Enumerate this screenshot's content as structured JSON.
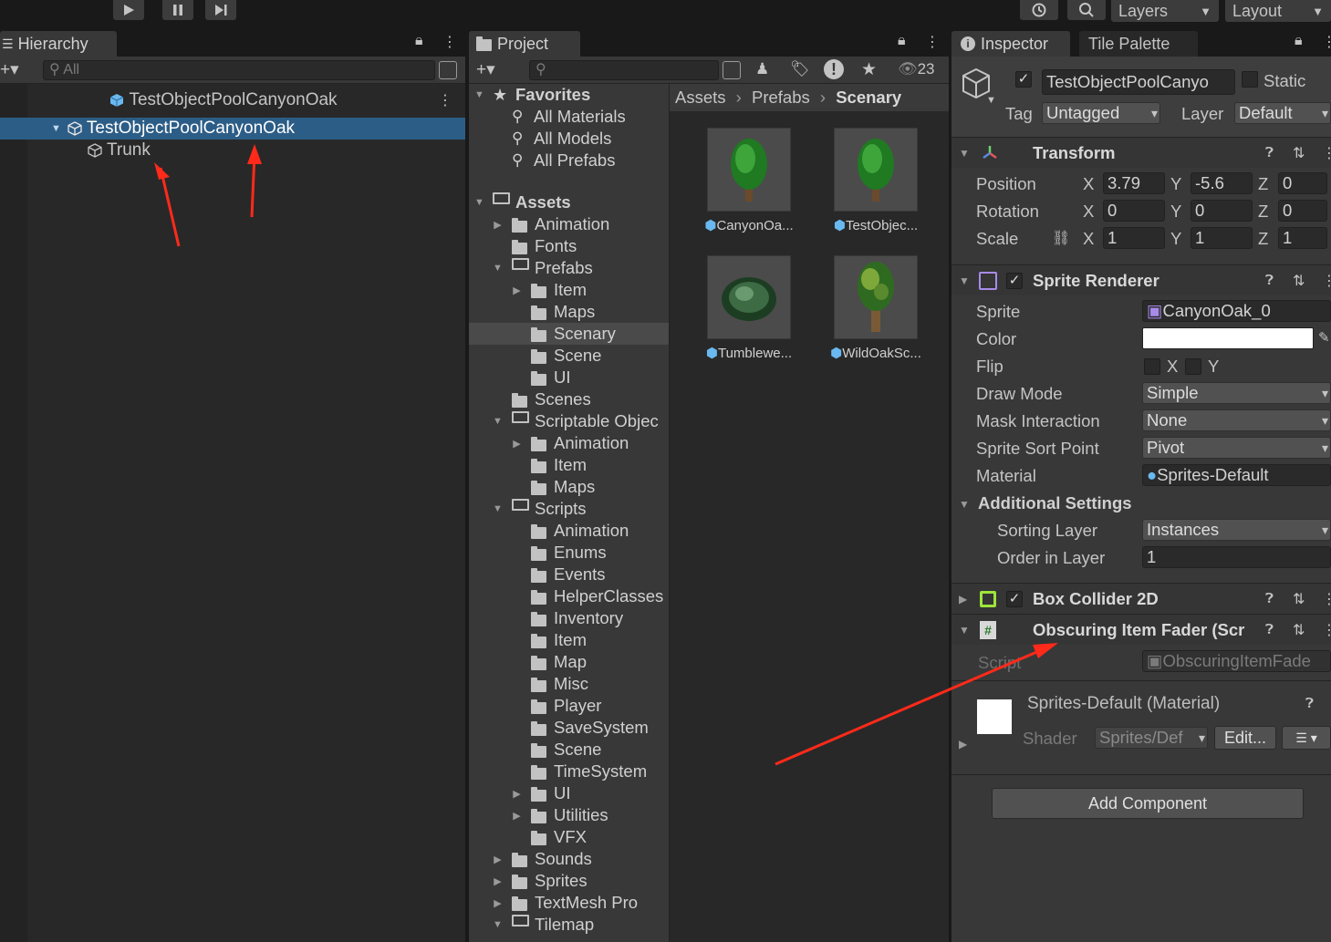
{
  "toolbar": {
    "layers_label": "Layers",
    "layout_label": "Layout"
  },
  "hierarchy": {
    "tab_label": "Hierarchy",
    "search_placeholder": "All",
    "scene_object": "TestObjectPoolCanyonOak",
    "selected_object": "TestObjectPoolCanyonOak",
    "child_object": "Trunk"
  },
  "project": {
    "tab_label": "Project",
    "hidden_count": "23",
    "breadcrumb": [
      "Assets",
      "Prefabs",
      "Scenary"
    ],
    "favorites_label": "Favorites",
    "favorites": [
      "All Materials",
      "All Models",
      "All Prefabs"
    ],
    "assets_label": "Assets",
    "tree": [
      {
        "label": "Animation",
        "indent": 1,
        "fold": "closed"
      },
      {
        "label": "Fonts",
        "indent": 1,
        "fold": "none"
      },
      {
        "label": "Prefabs",
        "indent": 1,
        "fold": "open"
      },
      {
        "label": "Item",
        "indent": 2,
        "fold": "closed"
      },
      {
        "label": "Maps",
        "indent": 2,
        "fold": "none"
      },
      {
        "label": "Scenary",
        "indent": 2,
        "fold": "none",
        "selected": true
      },
      {
        "label": "Scene",
        "indent": 2,
        "fold": "none"
      },
      {
        "label": "UI",
        "indent": 2,
        "fold": "none"
      },
      {
        "label": "Scenes",
        "indent": 1,
        "fold": "none"
      },
      {
        "label": "Scriptable Objec",
        "indent": 1,
        "fold": "open"
      },
      {
        "label": "Animation",
        "indent": 2,
        "fold": "closed"
      },
      {
        "label": "Item",
        "indent": 2,
        "fold": "none"
      },
      {
        "label": "Maps",
        "indent": 2,
        "fold": "none"
      },
      {
        "label": "Scripts",
        "indent": 1,
        "fold": "open"
      },
      {
        "label": "Animation",
        "indent": 2,
        "fold": "none"
      },
      {
        "label": "Enums",
        "indent": 2,
        "fold": "none"
      },
      {
        "label": "Events",
        "indent": 2,
        "fold": "none"
      },
      {
        "label": "HelperClasses",
        "indent": 2,
        "fold": "none"
      },
      {
        "label": "Inventory",
        "indent": 2,
        "fold": "none"
      },
      {
        "label": "Item",
        "indent": 2,
        "fold": "none"
      },
      {
        "label": "Map",
        "indent": 2,
        "fold": "none"
      },
      {
        "label": "Misc",
        "indent": 2,
        "fold": "none"
      },
      {
        "label": "Player",
        "indent": 2,
        "fold": "none"
      },
      {
        "label": "SaveSystem",
        "indent": 2,
        "fold": "none"
      },
      {
        "label": "Scene",
        "indent": 2,
        "fold": "none"
      },
      {
        "label": "TimeSystem",
        "indent": 2,
        "fold": "none"
      },
      {
        "label": "UI",
        "indent": 2,
        "fold": "closed"
      },
      {
        "label": "Utilities",
        "indent": 2,
        "fold": "closed"
      },
      {
        "label": "VFX",
        "indent": 2,
        "fold": "none"
      },
      {
        "label": "Sounds",
        "indent": 1,
        "fold": "closed"
      },
      {
        "label": "Sprites",
        "indent": 1,
        "fold": "closed"
      },
      {
        "label": "TextMesh Pro",
        "indent": 1,
        "fold": "closed"
      },
      {
        "label": "Tilemap",
        "indent": 1,
        "fold": "open"
      }
    ],
    "assets": [
      "CanyonOa...",
      "TestObjec...",
      "Tumblewe...",
      "WildOakSc..."
    ]
  },
  "inspector": {
    "tab_label": "Inspector",
    "tab2_label": "Tile Palette",
    "object_name": "TestObjectPoolCanyo",
    "static_label": "Static",
    "tag_label": "Tag",
    "tag_value": "Untagged",
    "layer_label": "Layer",
    "layer_value": "Default",
    "transform": {
      "title": "Transform",
      "position_label": "Position",
      "rotation_label": "Rotation",
      "scale_label": "Scale",
      "position": {
        "x": "3.79",
        "y": "-5.6",
        "z": "0"
      },
      "rotation": {
        "x": "0",
        "y": "0",
        "z": "0"
      },
      "scale": {
        "x": "1",
        "y": "1",
        "z": "1"
      }
    },
    "sprite_renderer": {
      "title": "Sprite Renderer",
      "sprite_label": "Sprite",
      "sprite_value": "CanyonOak_0",
      "color_label": "Color",
      "flip_label": "Flip",
      "flip_x": "X",
      "flip_y": "Y",
      "draw_mode_label": "Draw Mode",
      "draw_mode_value": "Simple",
      "mask_label": "Mask Interaction",
      "mask_value": "None",
      "sort_point_label": "Sprite Sort Point",
      "sort_point_value": "Pivot",
      "material_label": "Material",
      "material_value": "Sprites-Default",
      "additional_label": "Additional Settings",
      "sorting_layer_label": "Sorting Layer",
      "sorting_layer_value": "Instances",
      "order_label": "Order in Layer",
      "order_value": "1"
    },
    "box_collider": {
      "title": "Box Collider 2D"
    },
    "fader": {
      "title": "Obscuring Item Fader (Scr",
      "script_label": "Script",
      "script_value": "ObscuringItemFade"
    },
    "material": {
      "title": "Sprites-Default (Material)",
      "shader_label": "Shader",
      "shader_value": "Sprites/Def",
      "edit_label": "Edit..."
    },
    "add_component_label": "Add Component"
  }
}
